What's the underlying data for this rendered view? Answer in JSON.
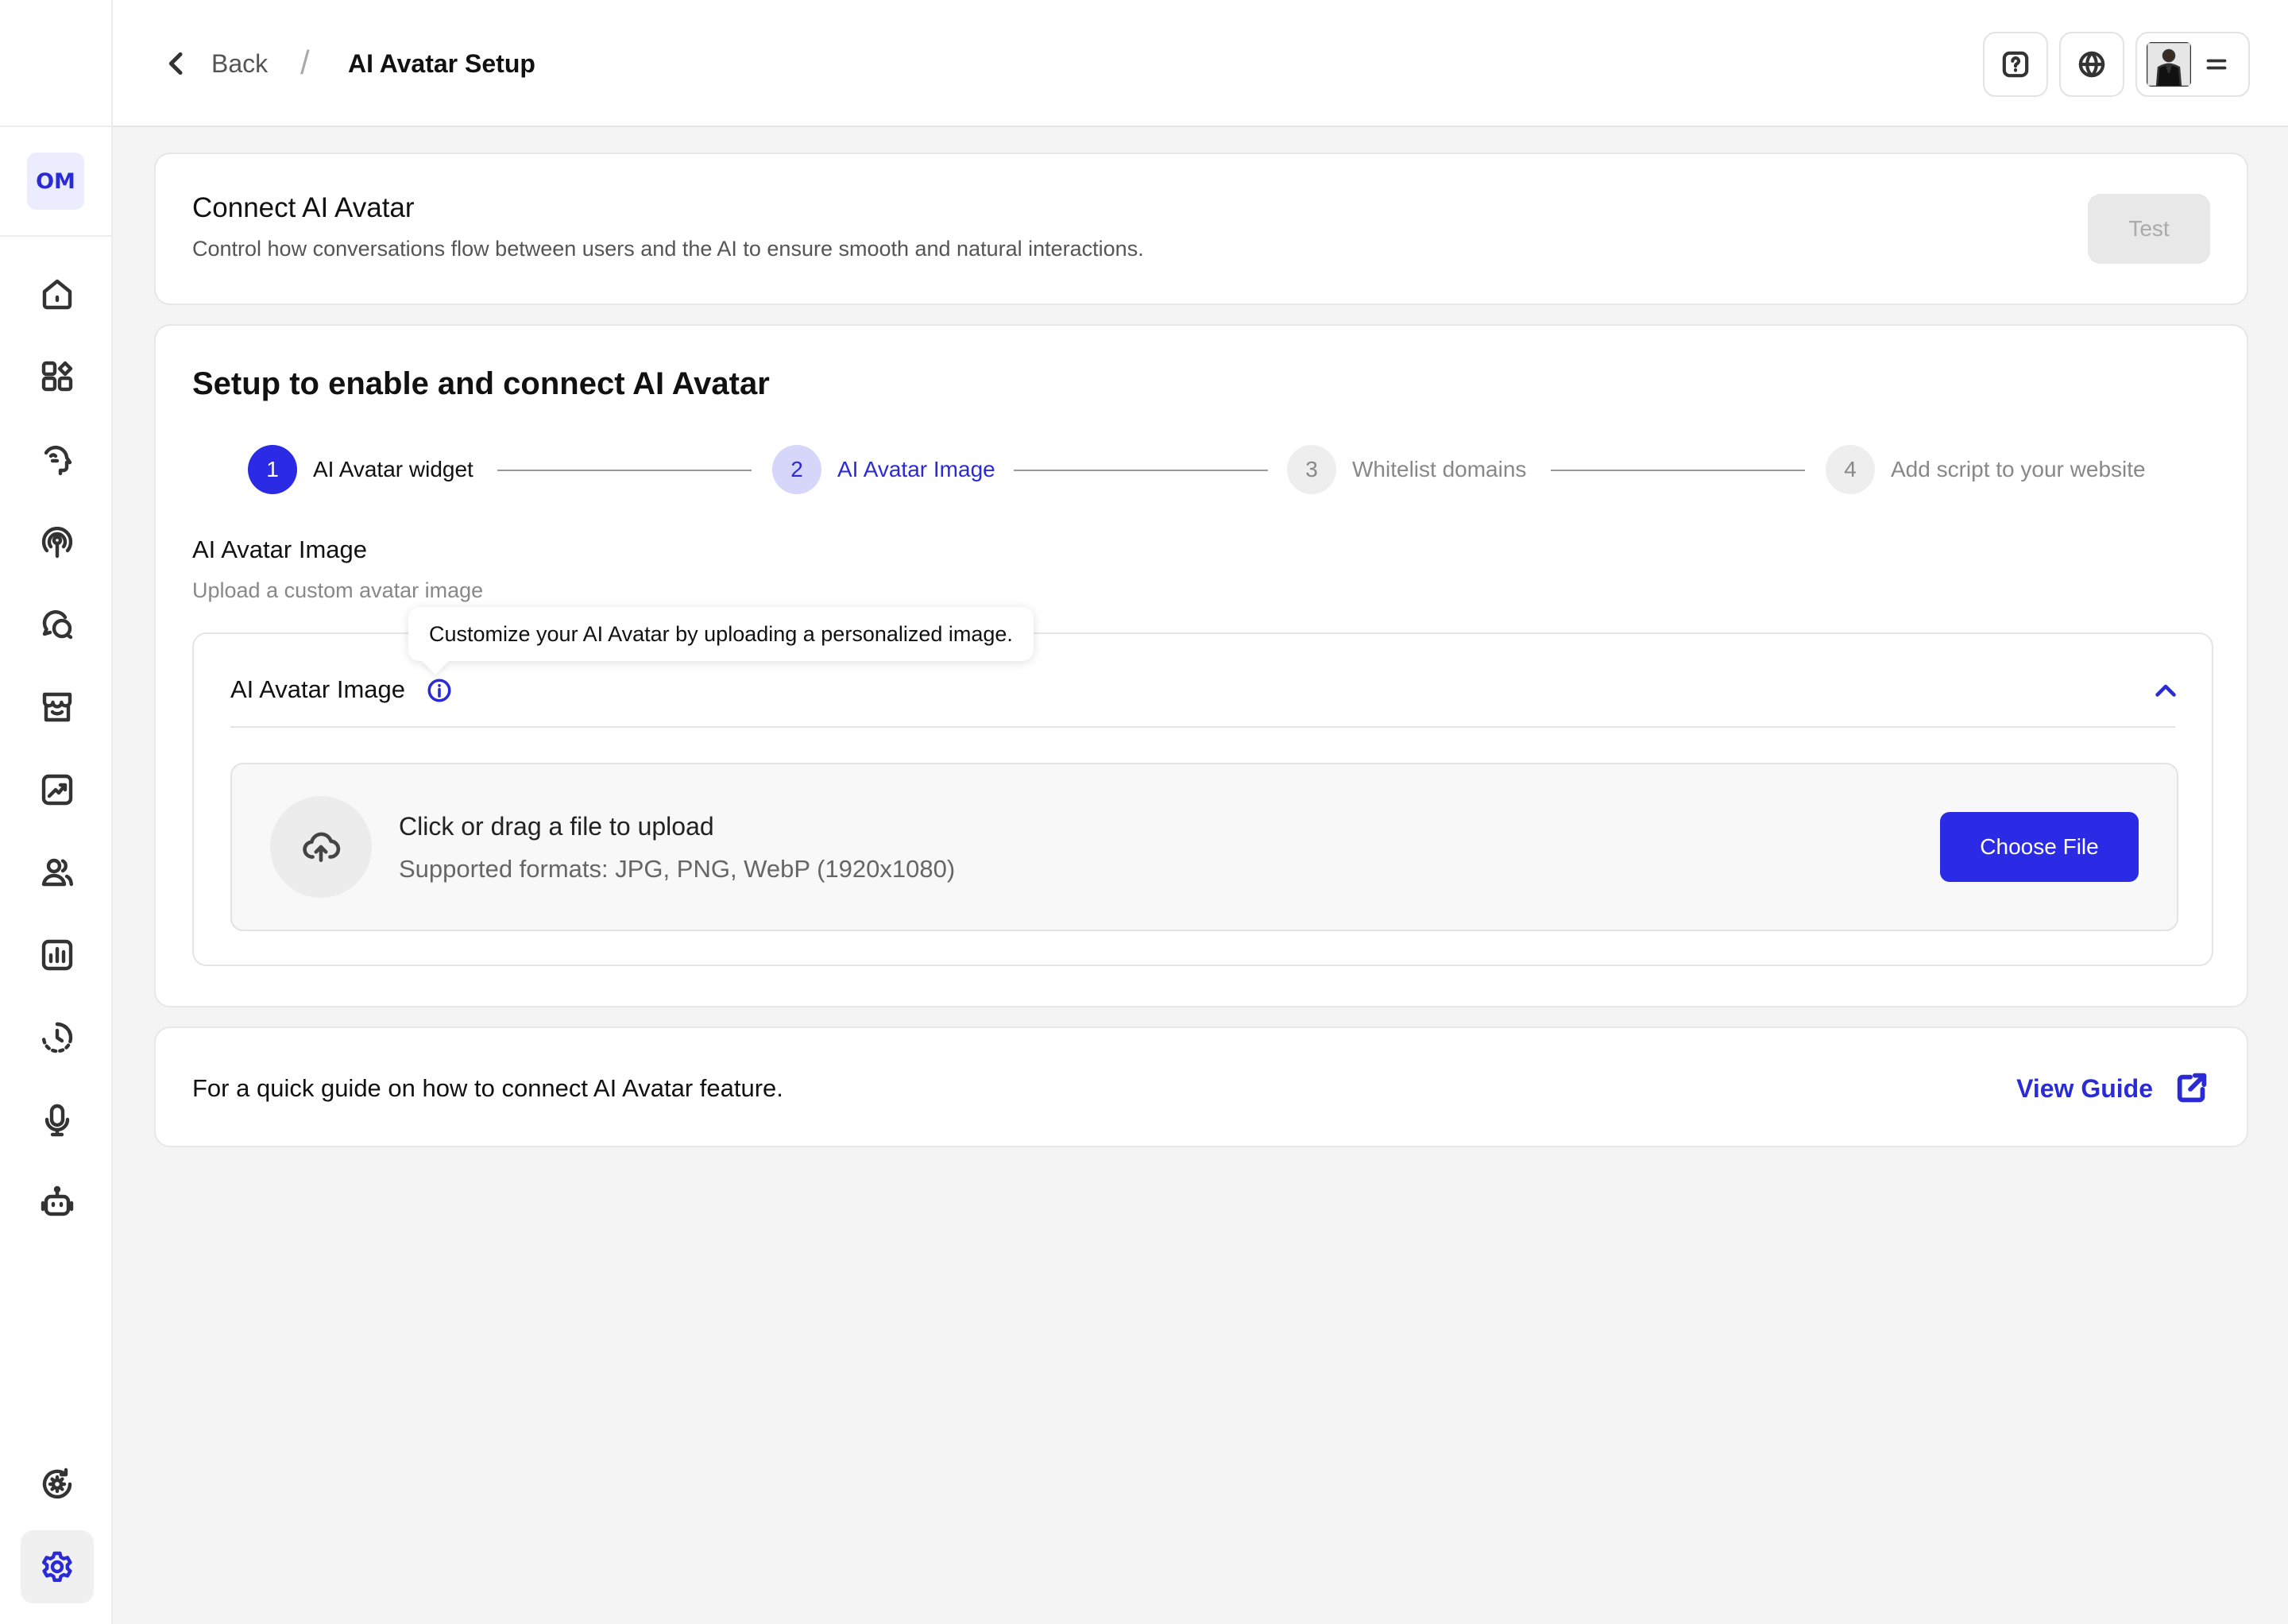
{
  "sidebar": {
    "org_badge": "OM",
    "items": [
      {
        "icon": "home-icon"
      },
      {
        "icon": "grid-icon"
      },
      {
        "icon": "head-brain-icon"
      },
      {
        "icon": "broadcast-icon"
      },
      {
        "icon": "chat-icon"
      },
      {
        "icon": "store-icon"
      },
      {
        "icon": "chart-up-icon"
      },
      {
        "icon": "users-icon"
      },
      {
        "icon": "bar-chart-icon"
      },
      {
        "icon": "history-icon"
      },
      {
        "icon": "microphone-icon"
      },
      {
        "icon": "robot-icon"
      }
    ],
    "bottom_items": [
      {
        "icon": "settings-refresh-icon"
      },
      {
        "icon": "settings-icon",
        "active": true
      }
    ]
  },
  "header": {
    "back_label": "Back",
    "separator": "/",
    "title": "AI Avatar Setup",
    "help_icon": "help-icon",
    "language_icon": "globe-icon",
    "menu_icon": "menu-icon"
  },
  "connect_card": {
    "title": "Connect AI Avatar",
    "description": "Control how conversations flow between users and the AI to ensure smooth and natural interactions.",
    "test_label": "Test"
  },
  "setup_card": {
    "title": "Setup to enable and connect AI Avatar",
    "steps": [
      {
        "number": "1",
        "label": "AI Avatar widget",
        "state": "completed"
      },
      {
        "number": "2",
        "label": "AI Avatar Image",
        "state": "current"
      },
      {
        "number": "3",
        "label": "Whitelist domains",
        "state": "upcoming"
      },
      {
        "number": "4",
        "label": "Add script to your website",
        "state": "upcoming"
      }
    ],
    "section_title": "AI Avatar Image",
    "section_subtitle": "Upload a custom avatar image",
    "panel": {
      "title": "AI Avatar Image",
      "tooltip": "Customize your AI Avatar by uploading a personalized image.",
      "upload_title": "Click or drag a file to upload",
      "upload_formats": "Supported formats: JPG, PNG, WebP (1920x1080)",
      "choose_file_label": "Choose File"
    }
  },
  "guide_card": {
    "text": "For a quick guide on how to connect AI Avatar feature.",
    "link_label": "View Guide"
  },
  "colors": {
    "accent": "#2b2be6",
    "accent_light": "#d6d6fb",
    "background": "#f4f4f4"
  }
}
